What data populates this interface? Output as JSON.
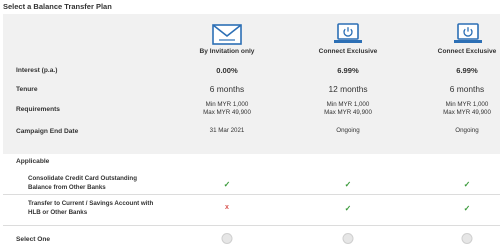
{
  "title": "Select a Balance Transfer Plan",
  "plans": [
    {
      "name": "By Invitation only",
      "icon": "envelope-icon",
      "interest": "0.00%",
      "tenure": "6 months",
      "req_min": "Min MYR 1,000",
      "req_max": "Max MYR 49,900",
      "end_date": "31 Mar 2021",
      "consolidate": "check",
      "transfer": "cross"
    },
    {
      "name": "Connect Exclusive",
      "icon": "laptop-power-icon",
      "interest": "6.99%",
      "tenure": "12 months",
      "req_min": "Min MYR 1,000",
      "req_max": "Max MYR 49,900",
      "end_date": "Ongoing",
      "consolidate": "check",
      "transfer": "check"
    },
    {
      "name": "Connect Exclusive",
      "icon": "laptop-power-icon",
      "interest": "6.99%",
      "tenure": "6 months",
      "req_min": "Min MYR 1,000",
      "req_max": "Max MYR 49,900",
      "end_date": "Ongoing",
      "consolidate": "check",
      "transfer": "check"
    }
  ],
  "rows": {
    "interest": "Interest (p.a.)",
    "tenure": "Tenure",
    "requirements": "Requirements",
    "end_date": "Campaign End Date"
  },
  "applicable": {
    "heading": "Applicable",
    "consolidate_line1": "Consolidate Credit Card Outstanding",
    "consolidate_line2": "Balance from Other Banks",
    "transfer_line1": "Transfer to Current / Savings Account with",
    "transfer_line2": "HLB or Other Banks"
  },
  "select_label": "Select One",
  "symbols": {
    "check": "✓",
    "cross": "x"
  },
  "colors": {
    "icon_blue": "#2c6fb5",
    "check": "#3a9a3a",
    "cross": "#d9534f",
    "panel": "#f1f1f1"
  }
}
